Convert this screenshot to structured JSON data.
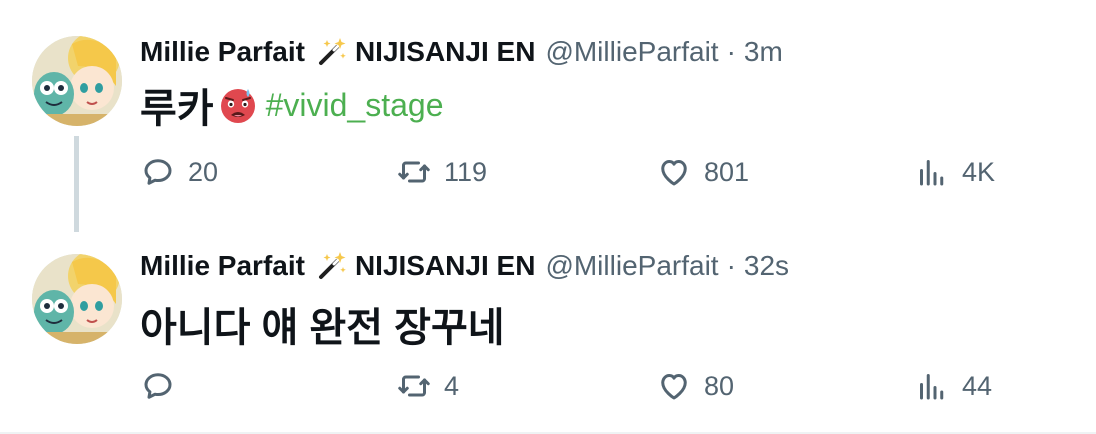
{
  "tweets": [
    {
      "author": {
        "display_name": "Millie Parfait",
        "name_emoji": "magic-wand-icon",
        "name_suffix": "NIJISANJI EN",
        "handle": "@MillieParfait",
        "separator": "·",
        "timestamp": "3m"
      },
      "text": "루카",
      "emoji": "hot-face-icon",
      "hashtag": "#vivid_stage",
      "actions": {
        "replies": "20",
        "retweets": "119",
        "likes": "801",
        "views": "4K"
      }
    },
    {
      "author": {
        "display_name": "Millie Parfait",
        "name_emoji": "magic-wand-icon",
        "name_suffix": "NIJISANJI EN",
        "handle": "@MillieParfait",
        "separator": "·",
        "timestamp": "32s"
      },
      "text": "아니다 얘 완전 장꾸네",
      "actions": {
        "replies": "",
        "retweets": "4",
        "likes": "80",
        "views": "44"
      }
    }
  ],
  "colors": {
    "text_primary": "#0f1419",
    "text_secondary": "#536471",
    "hashtag": "#4caf50",
    "thread_line": "#cfd9de"
  }
}
